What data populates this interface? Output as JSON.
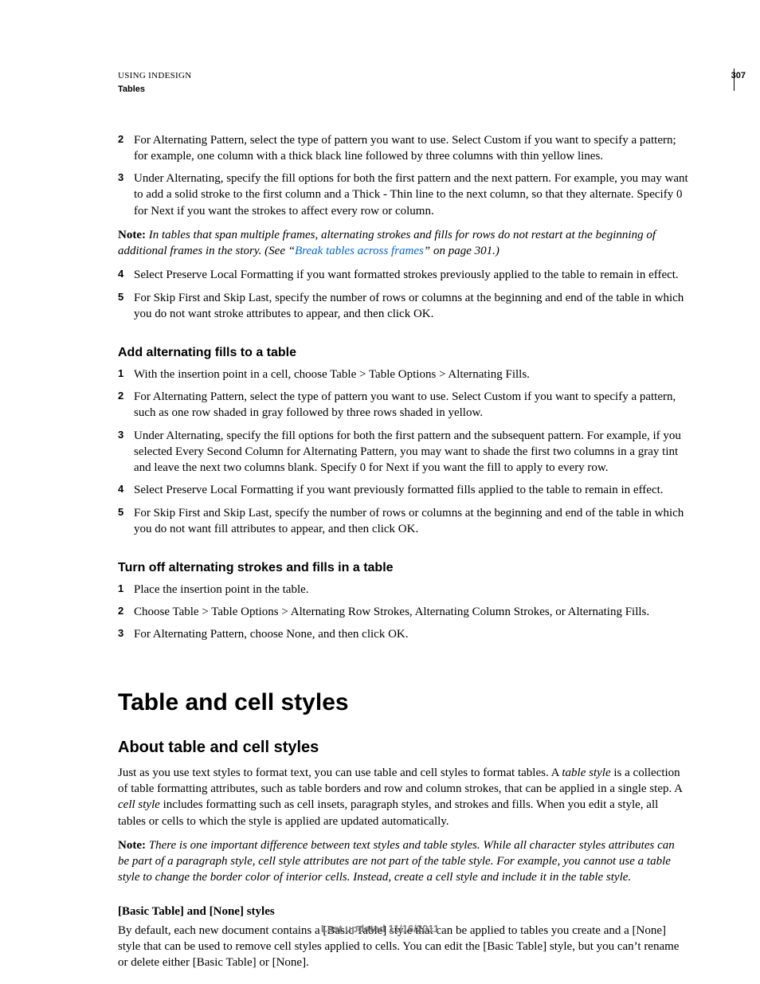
{
  "header": {
    "line1": "USING INDESIGN",
    "line2": "Tables",
    "page_number": "307"
  },
  "section1": {
    "steps": [
      {
        "n": "2",
        "text": "For Alternating Pattern, select the type of pattern you want to use. Select Custom if you want to specify a pattern; for example, one column with a thick black line followed by three columns with thin yellow lines."
      },
      {
        "n": "3",
        "text": "Under Alternating, specify the fill options for both the first pattern and the next pattern. For example, you may want to add a solid stroke to the first column and a Thick - Thin line to the next column, so that they alternate. Specify 0 for Next if you want the strokes to affect every row or column."
      }
    ],
    "note_prefix": "Note:",
    "note_before_link": " In tables that span multiple frames, alternating strokes and fills for rows do not restart at the beginning of additional frames in the story. (See “",
    "note_link": "Break tables across frames",
    "note_after_link": "” on page 301.)",
    "steps2": [
      {
        "n": "4",
        "text": "Select Preserve Local Formatting if you want formatted strokes previously applied to the table to remain in effect."
      },
      {
        "n": "5",
        "text": "For Skip First and Skip Last, specify the number of rows or columns at the beginning and end of the table in which you do not want stroke attributes to appear, and then click OK."
      }
    ]
  },
  "section2": {
    "heading": "Add alternating fills to a table",
    "steps": [
      {
        "n": "1",
        "text": "With the insertion point in a cell, choose Table > Table Options > Alternating Fills."
      },
      {
        "n": "2",
        "text": "For Alternating Pattern, select the type of pattern you want to use. Select Custom if you want to specify a pattern, such as one row shaded in gray followed by three rows shaded in yellow."
      },
      {
        "n": "3",
        "text": "Under Alternating, specify the fill options for both the first pattern and the subsequent pattern. For example, if you selected Every Second Column for Alternating Pattern, you may want to shade the first two columns in a gray tint and leave the next two columns blank. Specify 0 for Next if you want the fill to apply to every row."
      },
      {
        "n": "4",
        "text": "Select Preserve Local Formatting if you want previously formatted fills applied to the table to remain in effect."
      },
      {
        "n": "5",
        "text": "For Skip First and Skip Last, specify the number of rows or columns at the beginning and end of the table in which you do not want fill attributes to appear, and then click OK."
      }
    ]
  },
  "section3": {
    "heading": "Turn off alternating strokes and fills in a table",
    "steps": [
      {
        "n": "1",
        "text": "Place the insertion point in the table."
      },
      {
        "n": "2",
        "text": "Choose Table > Table Options > Alternating Row Strokes, Alternating Column Strokes, or Alternating Fills."
      },
      {
        "n": "3",
        "text": "For Alternating Pattern, choose None, and then click OK."
      }
    ]
  },
  "main_heading": "Table and cell styles",
  "section4": {
    "heading": "About table and cell styles",
    "para_before_ital1": "Just as you use text styles to format text, you can use table and cell styles to format tables. A ",
    "ital1": "table style",
    "para_mid": " is a collection of table formatting attributes, such as table borders and row and column strokes, that can be applied in a single step. A ",
    "ital2": "cell style",
    "para_after_ital2": " includes formatting such as cell insets, paragraph styles, and strokes and fills. When you edit a style, all tables or cells to which the style is applied are updated automatically.",
    "note_prefix": "Note:",
    "note_text": " There is one important difference between text styles and table styles. While all character styles attributes can be part of a paragraph style, cell style attributes are not part of the table style. For example, you cannot use a table style to change the border color of interior cells. Instead, create a cell style and include it in the table style.",
    "sub_heading": "[Basic Table] and [None] styles",
    "sub_para": "By default, each new document contains a [Basic Table] style that can be applied to tables you create and a [None] style that can be used to remove cell styles applied to cells. You can edit the [Basic Table] style, but you can’t rename or delete either [Basic Table] or [None]."
  },
  "footer": "Last updated 11/16/2011"
}
